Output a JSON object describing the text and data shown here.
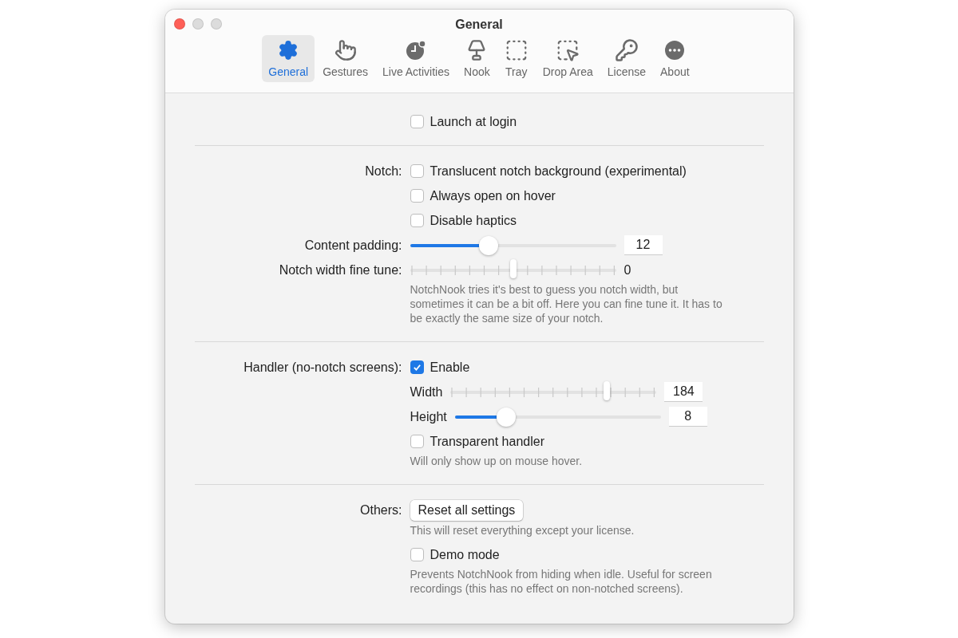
{
  "window": {
    "title": "General"
  },
  "tabs": [
    {
      "label": "General",
      "selected": true
    },
    {
      "label": "Gestures",
      "selected": false
    },
    {
      "label": "Live Activities",
      "selected": false
    },
    {
      "label": "Nook",
      "selected": false
    },
    {
      "label": "Tray",
      "selected": false
    },
    {
      "label": "Drop Area",
      "selected": false
    },
    {
      "label": "License",
      "selected": false
    },
    {
      "label": "About",
      "selected": false
    }
  ],
  "sections": [
    {
      "rows": [
        {
          "kind": "checkbox",
          "label": "Launch at login",
          "checked": false
        }
      ]
    },
    {
      "rows": [
        {
          "kind": "checkbox",
          "caption": "Notch:",
          "label": "Translucent notch background (experimental)",
          "checked": false
        },
        {
          "kind": "checkbox",
          "label": "Always open on hover",
          "checked": false
        },
        {
          "kind": "checkbox",
          "label": "Disable haptics",
          "checked": false
        },
        {
          "kind": "slider",
          "caption": "Content padding:",
          "ticks": false,
          "level": 0.38,
          "value": "12"
        },
        {
          "kind": "slider",
          "caption": "Notch width fine tune:",
          "ticks": true,
          "level": 0.5,
          "reading": "0"
        },
        {
          "kind": "note",
          "text": "NotchNook tries it's best to guess you notch width, but sometimes it can be a bit off. Here you can fine tune it. It has to be exactly the same size of your notch."
        }
      ]
    },
    {
      "rows": [
        {
          "kind": "checkbox",
          "caption": "Handler (no-notch screens):",
          "label": "Enable",
          "checked": true
        },
        {
          "kind": "slider",
          "label": "Width",
          "ticks": true,
          "level": 0.76,
          "value": "184"
        },
        {
          "kind": "slider",
          "label": "Height",
          "ticks": false,
          "level": 0.25,
          "value": "8"
        },
        {
          "kind": "checkbox",
          "label": "Transparent handler",
          "checked": false
        },
        {
          "kind": "note",
          "text": "Will only show up on mouse hover."
        }
      ]
    },
    {
      "rows": [
        {
          "kind": "button",
          "caption": "Others:",
          "label": "Reset all settings"
        },
        {
          "kind": "note",
          "text": "This will reset everything except your license."
        },
        {
          "kind": "checkbox",
          "label": "Demo mode",
          "checked": false
        },
        {
          "kind": "note",
          "text": "Prevents NotchNook from hiding when idle. Useful for screen recordings (this has no effect on non-notched screens)."
        }
      ]
    }
  ]
}
